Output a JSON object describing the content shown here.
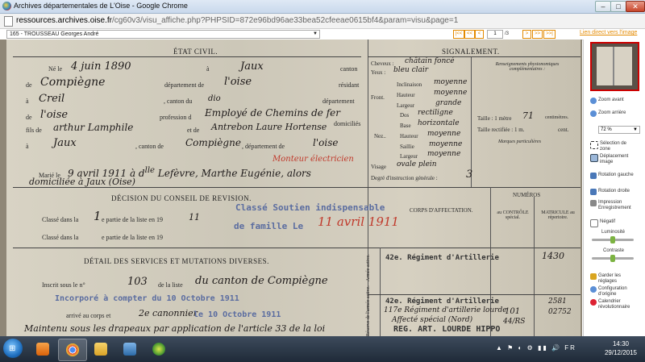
{
  "window": {
    "title": "Archives départementales de L'Oise - Google Chrome",
    "min": "–",
    "max": "□",
    "close": "✕"
  },
  "address": {
    "host": "ressources.archives.oise.fr",
    "path": "/cg60v3/visu_affiche.php?PHPSID=872e96bd96ae33bea52cfeeae0615bf4&param=visu&page=1"
  },
  "viewer": {
    "record": "165 - TROUSSEAU Georges André",
    "nav": [
      "|<<",
      "<<",
      "<"
    ],
    "nav_next": [
      ">",
      ">>",
      ">>|"
    ],
    "page": "1",
    "page_total": "/3",
    "link": "Lien direct vers l'image"
  },
  "doc": {
    "etat_civil": "ÉTAT CIVIL.",
    "signalement": "SIGNALEMENT.",
    "ne_le": "Né le",
    "born_date": "4 juin 1890",
    "a": "à",
    "born_place": "Jaux",
    "canton": "canton",
    "de": "de",
    "canton_name": "Compiègne",
    "departement_de": "département de",
    "dept_name": "l'oise",
    "residant": "résidant",
    "a2": "à",
    "resid_place": "Creil",
    "canton_du": ", canton du",
    "canton_du_val": "dio",
    "departement": "département",
    "de2": "de",
    "dept2": "l'oise",
    "profession": "profession d",
    "profession_val": "Employé de Chemins de fer",
    "domicilies": "domiciliés",
    "fils_de": "fils de",
    "father": "arthur Lamphile",
    "et_de": "et de",
    "mother": "Antrebon Laure Hortense",
    "a3": "à",
    "par_place": "Jaux",
    "canton_de": ", canton de",
    "par_canton": "Compiègne",
    "dept_de": ", département de",
    "par_dept": "l'oise",
    "red_note": "Monteur électricien",
    "marie_le": "Marié le",
    "marriage": "9 avril 1911 à d<sup>lle</sup> Lefèvre, Marthe Eugénie, alors",
    "domicile": "domiciliée à Jaux (Oise)",
    "cheveux": "Cheveux :",
    "cheveux_val": "châtain foncé",
    "yeux": "Yeux :",
    "yeux_val": "bleu clair",
    "front": "Front.",
    "inclinaison": "Inclinaison",
    "inclinaison_val": "moyenne",
    "hauteur": "Hauteur",
    "hauteur_val": "moyenne",
    "largeur": "Largeur",
    "largeur_val": "grande",
    "nez": "Nez..",
    "dos": "Dos",
    "dos_val": "rectiligne",
    "base": "Base",
    "base_val": "horizontale",
    "nez_hauteur": "Hauteur",
    "nez_hauteur_val": "moyenne",
    "saillie": "Saillie",
    "saillie_val": "moyenne",
    "nez_largeur": "Largeur",
    "nez_largeur_val": "moyenne",
    "visage": "Visage",
    "visage_val": "ovale plein",
    "degre": "Degré d'instruction générale :",
    "degre_val": "3",
    "renseignements": "Renseignements physionomiques complémentaires :",
    "taille": "Taille : 1 mètre",
    "taille_val": "71",
    "centimetres": "centimètres.",
    "taille_rect": "Taille rectifiée : 1 m.",
    "cent": "cent.",
    "marques": "Marques particulières",
    "decision": "DÉCISION DU CONSEIL DE REVISION.",
    "classe1": "Classé dans la",
    "classe1_num": "1",
    "classe1_rest": "e partie de la liste en 19",
    "classe1_year": "11",
    "classe2": "Classé dans la",
    "classe2_rest": "e partie de la liste en 19",
    "stamp1": "Classé Soutien indispensable",
    "stamp2": "de famille Le",
    "stamp2_red": "11 avril 1911",
    "corps": "CORPS D'AFFECTATION.",
    "numeros": "NUMÉROS",
    "col_controle": "au CONTRÔLE spécial.",
    "col_matricule": "MATRICULE au répertoire.",
    "detail": "DÉTAIL DES SERVICES ET MUTATIONS DIVERSES.",
    "inscrit": "Inscrit sous le n°",
    "inscrit_num": "103",
    "inscrit_rest": "de la liste",
    "inscrit_canton": "du canton de Compiègne",
    "incorpore": "Incorporé à compter du 10 Octobre 1911",
    "arrive": "arrivé au corps et",
    "arrive_hw": "2e canonnier",
    "arrive_date": "le 10 Octobre 1911",
    "maintenu": "Maintenu sous les drapeaux par application de l'article 33 de la loi",
    "armee_active": "Armée active.",
    "regiment1": "42e. Régiment d'Artillerie",
    "num1": "1430",
    "reserve": "Réserve de l'armée active.",
    "regiment2": "42e. Régiment d'Artillerie",
    "regiment2b": "117e Régiment d'artillerie lourde",
    "regiment2c": "Affecté spécial (Nord)",
    "regiment2d": "REG. ART. LOURDE HIPPO",
    "num2a": "101",
    "num2b": "44/RS",
    "num3a": "2581",
    "num3b": "02752"
  },
  "sidebar": {
    "zoom_avant": "Zoom avant",
    "zoom_arriere": "Zoom arrière",
    "zoom_level": "72 %",
    "selection": "Sélection de zone",
    "deplacement": "Déplacement image",
    "rot_gauche": "Rotation gauche",
    "rot_droite": "Rotation droite",
    "impression": "Impression",
    "enregistrement": "Enregistrement",
    "negatif": "Négatif",
    "luminosite": "Luminosité",
    "contraste": "Contraste",
    "garder": "Garder les réglages",
    "config": "Configuration d'origine",
    "calendrier": "Calendrier révolutionnaire"
  },
  "taskbar": {
    "time": "14:30",
    "date": "29/12/2015",
    "tray": "▲ ⚑ ◐ ⚙ ▮▮ 🔊 FR"
  }
}
